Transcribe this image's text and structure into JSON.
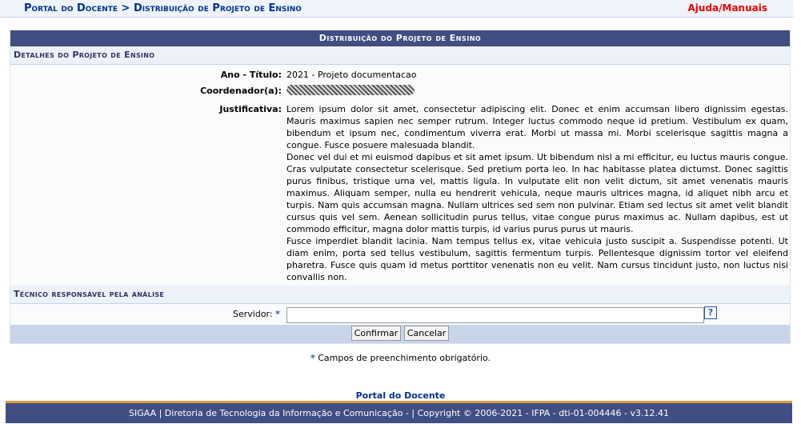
{
  "header": {
    "breadcrumb": "Portal do Docente > Distribuição de Projeto de Ensino",
    "help": "Ajuda/Manuais"
  },
  "form": {
    "caption": "Distribuição do Projeto de Ensino",
    "details_title": "Detalhes do Projeto de Ensino",
    "ano_label": "Ano - Título:",
    "ano_value": "2021 - Projeto documentacao",
    "coord_label": "Coordenador(a):",
    "just_label": "Justificativa:",
    "just_paragraphs": [
      "Lorem ipsum dolor sit amet, consectetur adipiscing elit. Donec et enim accumsan libero dignissim egestas. Mauris maximus sapien nec semper rutrum. Integer luctus commodo neque id pretium. Vestibulum ex quam, bibendum et ipsum nec, condimentum viverra erat. Morbi ut massa mi. Morbi scelerisque sagittis magna a congue. Fusce posuere malesuada blandit.",
      "Donec vel dui et mi euismod dapibus et sit amet ipsum. Ut bibendum nisl a mi efficitur, eu luctus mauris congue. Cras vulputate consectetur scelerisque. Sed pretium porta leo. In hac habitasse platea dictumst. Donec sagittis purus finibus, tristique urna vel, mattis ligula. In vulputate elit non velit dictum, sit amet venenatis mauris maximus. Aliquam semper, nulla eu hendrerit vehicula, neque mauris ultrices magna, id aliquet nibh arcu et turpis. Nam quis accumsan magna. Nullam ultrices sed sem non pulvinar. Etiam sed lectus sit amet velit blandit cursus quis vel sem. Aenean sollicitudin purus tellus, vitae congue purus maximus ac. Nullam dapibus, est ut commodo efficitur, magna dolor mattis turpis, id varius purus purus ut mauris.",
      "Fusce imperdiet blandit lacinia. Nam tempus tellus ex, vitae vehicula justo suscipit a. Suspendisse potenti. Ut diam enim, porta sed tellus vestibulum, sagittis fermentum turpis. Pellentesque dignissim tortor vel eleifend pharetra. Fusce quis quam id metus porttitor venenatis non eu velit. Nam cursus tincidunt justo, non luctus nisi convallis non."
    ],
    "tecnico_title": "Técnico responsável pela análise",
    "servidor_label": "Servidor:",
    "required_mark": "*",
    "servidor_value": "",
    "help_mark": "?",
    "confirm": "Confirmar",
    "cancel": "Cancelar"
  },
  "required_note": "Campos de preenchimento obrigatório.",
  "footer": {
    "portal_link": "Portal do Docente",
    "text": "SIGAA | Diretoria de Tecnologia da Informação e Comunicação - | Copyright © 2006-2021 - IFPA - dti-01-004446 - v3.12.41"
  }
}
